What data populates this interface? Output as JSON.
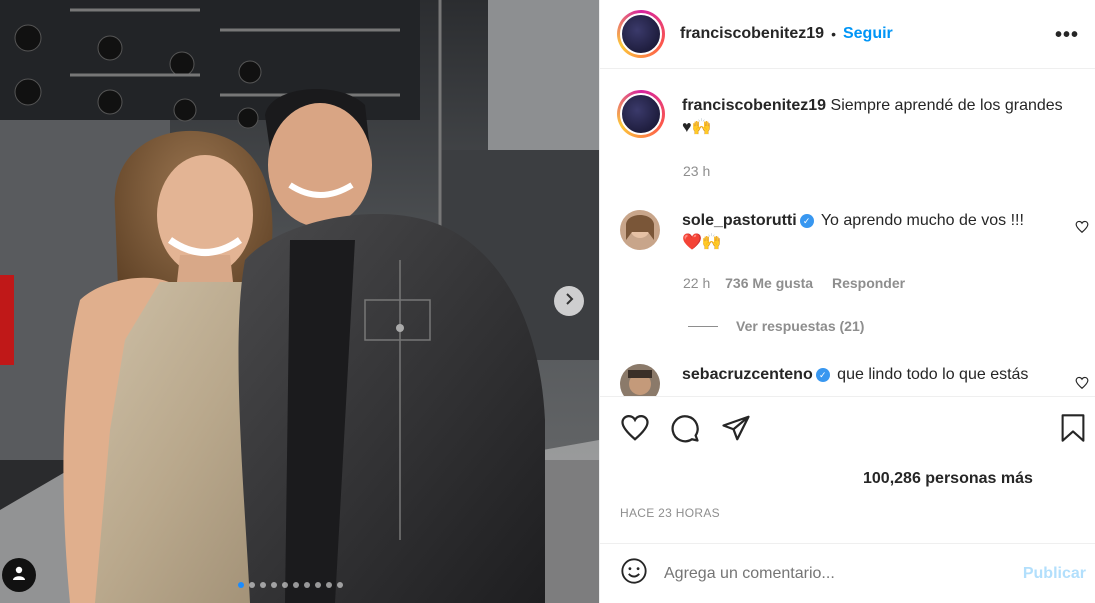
{
  "post": {
    "carousel_count": 10,
    "carousel_active": 1
  },
  "header": {
    "username": "franciscobenitez19",
    "separator": "•",
    "follow_label": "Seguir",
    "more_label": "•••"
  },
  "caption": {
    "username": "franciscobenitez19",
    "text": "Siempre aprendé de los grandes",
    "emoji": "♥🙌",
    "time": "23 h"
  },
  "comments": [
    {
      "username": "sole_pastorutti",
      "verified": true,
      "text": "Yo aprendo mucho de vos !!!",
      "emoji": "❤️🙌",
      "time": "22 h",
      "likes": "736 Me gusta",
      "reply": "Responder",
      "view_replies": "Ver respuestas (21)"
    },
    {
      "username": "sebacruzcenteno",
      "verified": true,
      "text": "que lindo todo lo que estás"
    }
  ],
  "likes_text": "100,286 personas más",
  "post_time": "HACE 23 HORAS",
  "add_comment": {
    "placeholder": "Agrega un comentario...",
    "post_label": "Publicar"
  },
  "colors": {
    "link": "#0095f6",
    "verified": "#3897f0",
    "muted": "#8e8e8e"
  }
}
